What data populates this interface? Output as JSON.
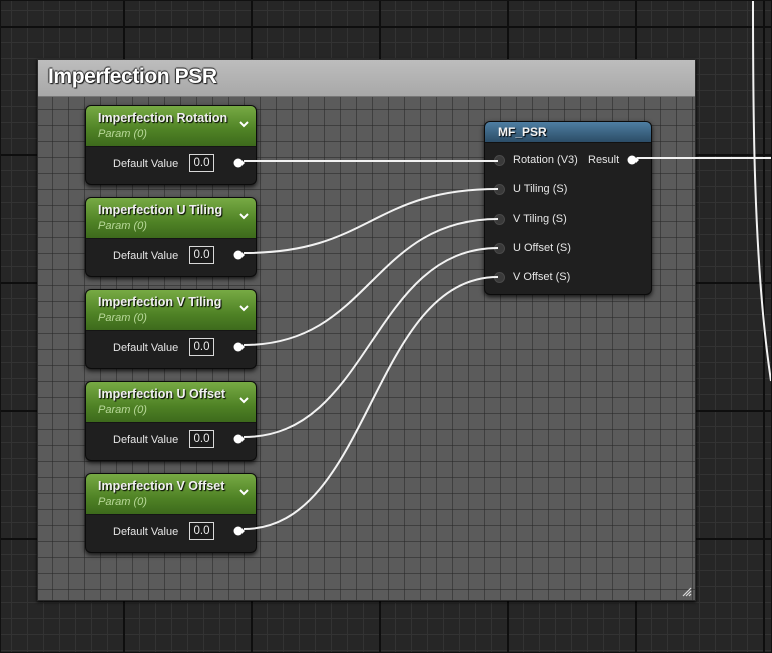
{
  "comment": {
    "title": "Imperfection PSR",
    "resize_icon": "resize-grip-icon"
  },
  "param_nodes": [
    {
      "title": "Imperfection Rotation",
      "subtitle": "Param (0)",
      "label": "Default Value",
      "value": "0.0"
    },
    {
      "title": "Imperfection U Tiling",
      "subtitle": "Param (0)",
      "label": "Default Value",
      "value": "0.0"
    },
    {
      "title": "Imperfection V Tiling",
      "subtitle": "Param (0)",
      "label": "Default Value",
      "value": "0.0"
    },
    {
      "title": "Imperfection U Offset",
      "subtitle": "Param (0)",
      "label": "Default Value",
      "value": "0.0"
    },
    {
      "title": "Imperfection V Offset",
      "subtitle": "Param (0)",
      "label": "Default Value",
      "value": "0.0"
    }
  ],
  "function_node": {
    "title": "MF_PSR",
    "inputs": [
      "Rotation (V3)",
      "U Tiling (S)",
      "V Tiling (S)",
      "U Offset (S)",
      "V Offset (S)"
    ],
    "output": "Result"
  },
  "colors": {
    "param_header": "#5e9330",
    "function_header": "#3d6685",
    "comment_header": "#b3b3b3",
    "wire": "#ffffff"
  },
  "icons": {
    "collapse": "chevron-down-icon",
    "pin": "output-pin-icon"
  }
}
